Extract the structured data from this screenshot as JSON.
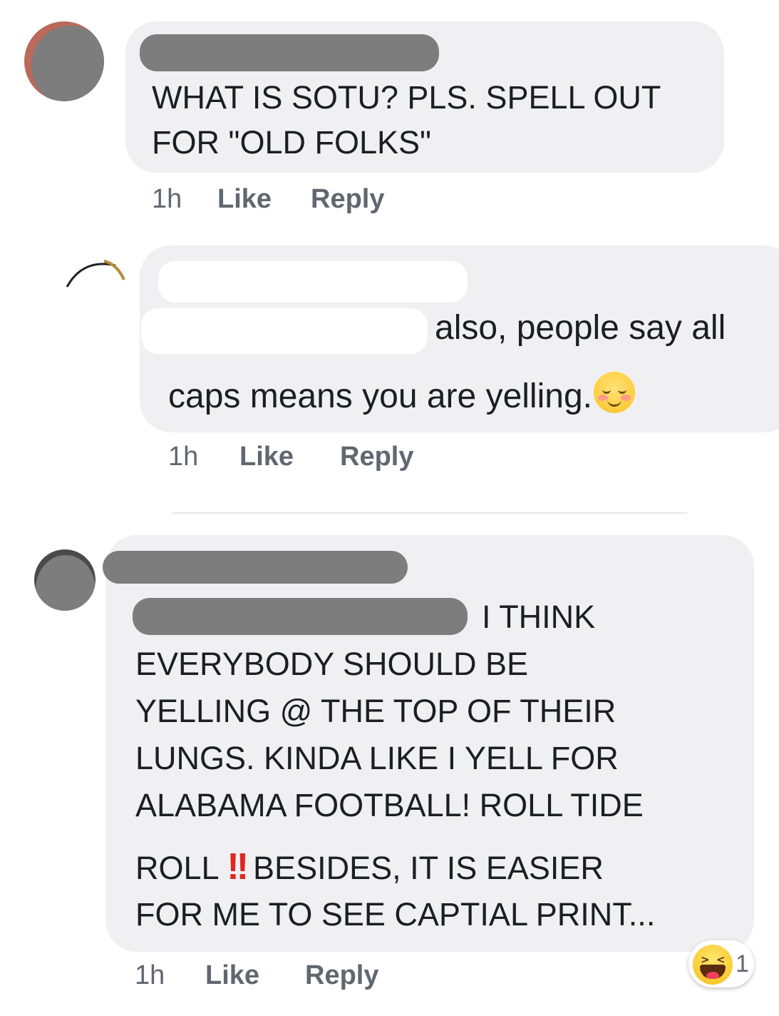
{
  "comments": [
    {
      "text_lines": [
        "WHAT IS SOTU?  PLS. SPELL OUT",
        "FOR \"OLD FOLKS\""
      ],
      "time": "1h",
      "like_label": "Like",
      "reply_label": "Reply"
    },
    {
      "text_lines": [
        "also, people say all",
        "caps means you are yelling."
      ],
      "emoji": "relieved-face-emoji",
      "time": "1h",
      "like_label": "Like",
      "reply_label": "Reply"
    },
    {
      "text_lines": [
        "I THINK",
        "EVERYBODY SHOULD BE",
        "YELLING @ THE TOP OF THEIR",
        "LUNGS.  KINDA LIKE I YELL FOR",
        "ALABAMA FOOTBALL!  ROLL TIDE",
        "ROLL",
        "!!",
        "BESIDES, IT IS EASIER",
        "FOR ME TO SEE CAPTIAL PRINT..."
      ],
      "time": "1h",
      "like_label": "Like",
      "reply_label": "Reply",
      "reaction": {
        "icon": "haha-reaction-icon",
        "count": "1"
      }
    }
  ],
  "colors": {
    "bubble": "#f0f0f2",
    "meta_text": "#606770",
    "redaction": "#7d7d7d",
    "double_exclamation": "#e0261f"
  }
}
